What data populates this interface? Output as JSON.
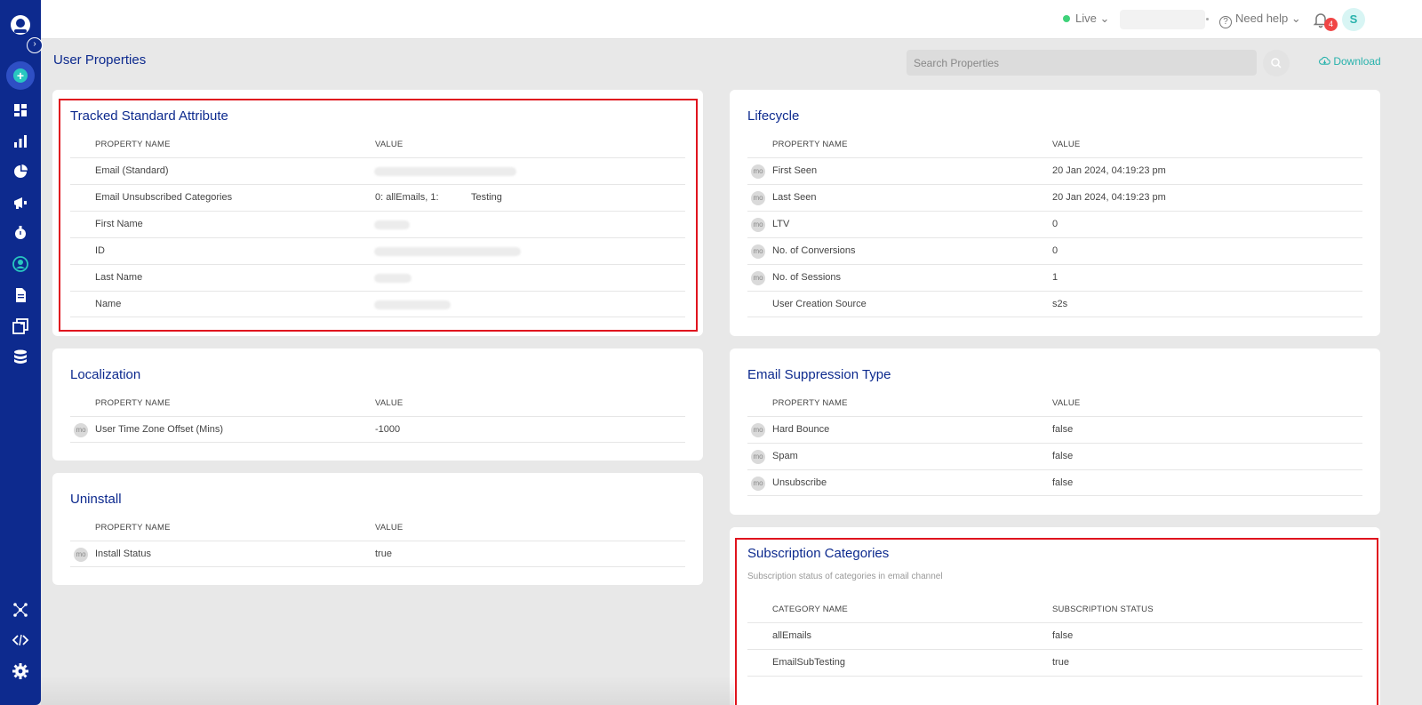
{
  "header": {
    "env_label": "Live",
    "help_label": "Need help",
    "notification_count": "4",
    "avatar_initial": "S"
  },
  "page": {
    "title": "User Properties",
    "search_placeholder": "Search Properties",
    "download_label": "Download"
  },
  "sidebar": {
    "items": [
      "dashboard-icon",
      "analytics-icon",
      "segments-icon",
      "campaigns-icon",
      "flows-icon",
      "user-icon",
      "content-icon",
      "templates-icon",
      "data-icon",
      "integrations-icon",
      "code-icon",
      "settings-icon"
    ]
  },
  "cards": {
    "tracked": {
      "title": "Tracked Standard Attribute",
      "col1": "PROPERTY NAME",
      "col2": "VALUE",
      "rows": [
        {
          "name": "Email (Standard)",
          "value": ""
        },
        {
          "name": "Email Unsubscribed Categories",
          "value": "0: allEmails, 1:            Testing"
        },
        {
          "name": "First Name",
          "value": ""
        },
        {
          "name": "ID",
          "value": ""
        },
        {
          "name": "Last Name",
          "value": ""
        },
        {
          "name": "Name",
          "value": ""
        }
      ]
    },
    "localization": {
      "title": "Localization",
      "col1": "PROPERTY NAME",
      "col2": "VALUE",
      "rows": [
        {
          "badge": "mo",
          "name": "User Time Zone Offset (Mins)",
          "value": "-1000"
        }
      ]
    },
    "uninstall": {
      "title": "Uninstall",
      "col1": "PROPERTY NAME",
      "col2": "VALUE",
      "rows": [
        {
          "badge": "mo",
          "name": "Install Status",
          "value": "true"
        }
      ]
    },
    "lifecycle": {
      "title": "Lifecycle",
      "col1": "PROPERTY NAME",
      "col2": "VALUE",
      "rows": [
        {
          "badge": "mo",
          "name": "First Seen",
          "value": "20 Jan 2024, 04:19:23 pm"
        },
        {
          "badge": "mo",
          "name": "Last Seen",
          "value": "20 Jan 2024, 04:19:23 pm"
        },
        {
          "badge": "mo",
          "name": "LTV",
          "value": "0"
        },
        {
          "badge": "mo",
          "name": "No. of Conversions",
          "value": "0"
        },
        {
          "badge": "mo",
          "name": "No. of Sessions",
          "value": "1"
        },
        {
          "badge": "",
          "name": "User Creation Source",
          "value": "s2s"
        }
      ]
    },
    "suppression": {
      "title": "Email Suppression Type",
      "col1": "PROPERTY NAME",
      "col2": "VALUE",
      "rows": [
        {
          "badge": "mo",
          "name": "Hard Bounce",
          "value": "false"
        },
        {
          "badge": "mo",
          "name": "Spam",
          "value": "false"
        },
        {
          "badge": "mo",
          "name": "Unsubscribe",
          "value": "false"
        }
      ]
    },
    "subscription": {
      "title": "Subscription Categories",
      "description": "Subscription status of categories in email channel",
      "col1": "CATEGORY NAME",
      "col2": "SUBSCRIPTION STATUS",
      "rows": [
        {
          "name": "allEmails",
          "value": "false"
        },
        {
          "name": "EmailSubTesting",
          "value": "true"
        }
      ]
    }
  }
}
